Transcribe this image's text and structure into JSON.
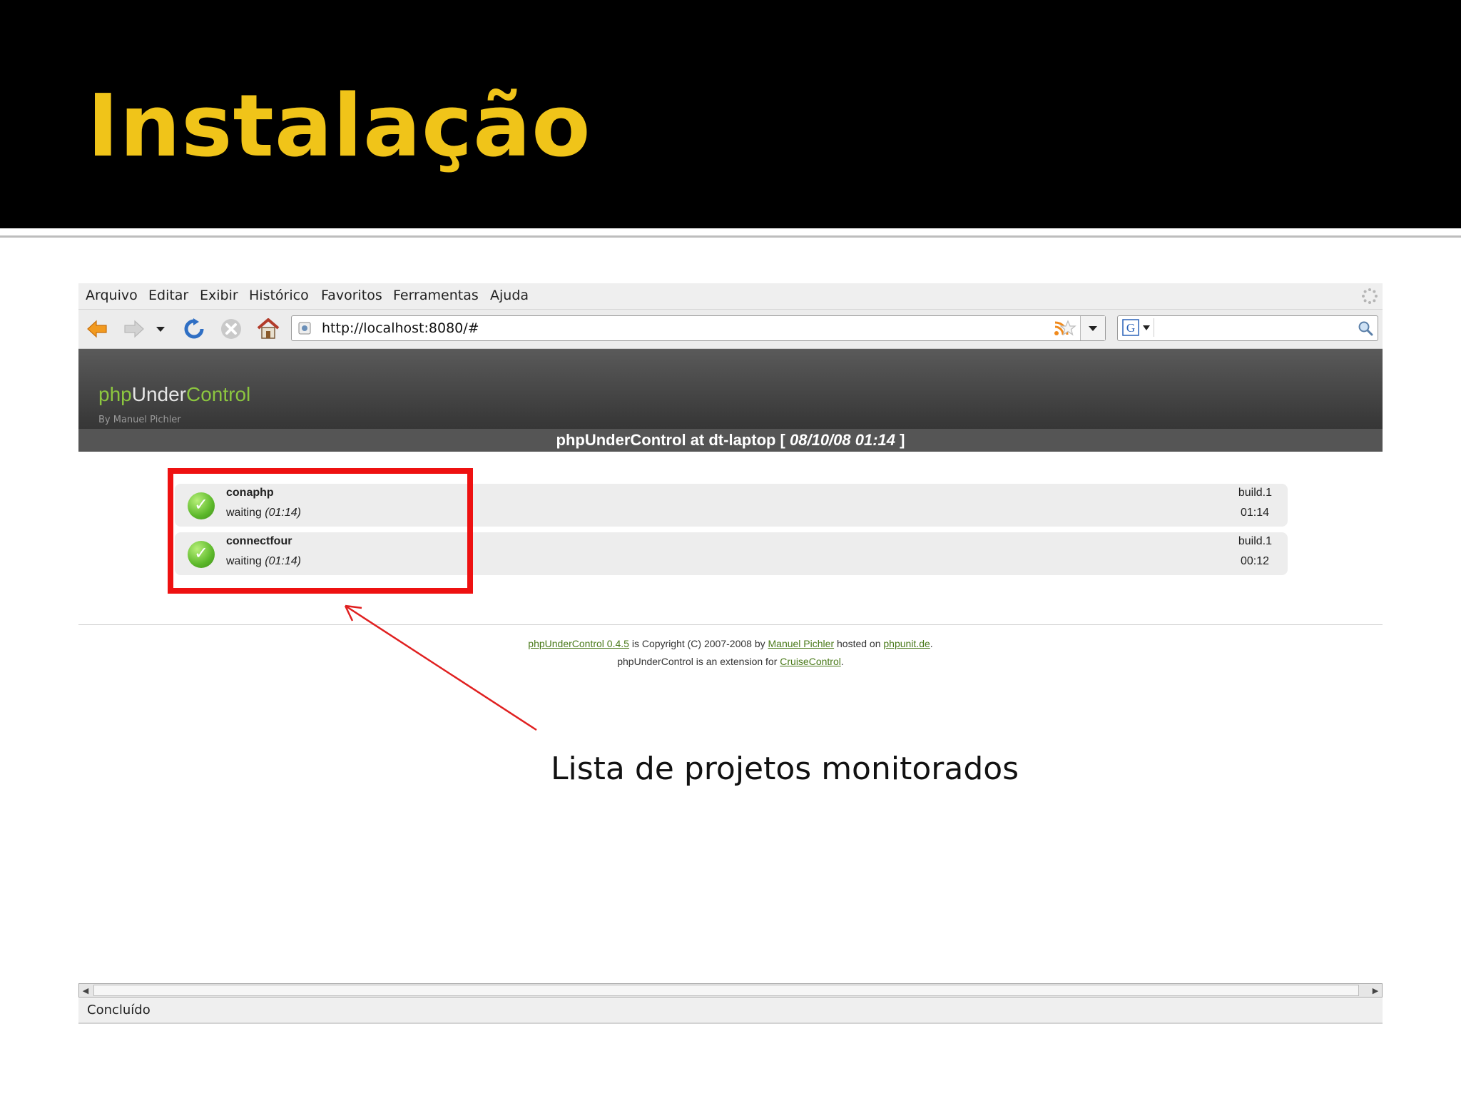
{
  "slide": {
    "title": "Instalação",
    "caption": "Lista de projetos monitorados"
  },
  "browser": {
    "menu": [
      "Arquivo",
      "Editar",
      "Exibir",
      "Histórico",
      "Favoritos",
      "Ferramentas",
      "Ajuda"
    ],
    "url": "http://localhost:8080/#",
    "search_placeholder": "",
    "status": "Concluído",
    "icons": [
      "back-arrow-icon",
      "forward-arrow-icon",
      "history-dropdown-icon",
      "reload-icon",
      "stop-icon",
      "home-icon",
      "site-identity-icon",
      "rss-feed-icon",
      "bookmark-star-icon",
      "google-search-icon",
      "magnifier-icon"
    ]
  },
  "page": {
    "logo": {
      "part1": "php",
      "part2": "Under",
      "part3": "Control",
      "byline": "By Manuel Pichler"
    },
    "header": {
      "prefix": "phpUnderControl at dt-laptop [ ",
      "timestamp": "08/10/08 01:14",
      "suffix": " ]"
    },
    "projects": [
      {
        "name": "conaphp",
        "state": "waiting",
        "since": "(01:14)",
        "build": "build.1",
        "time": "01:14"
      },
      {
        "name": "connectfour",
        "state": "waiting",
        "since": "(01:14)",
        "build": "build.1",
        "time": "00:12"
      }
    ],
    "footer": {
      "line1_link1": "phpUnderControl 0.4.5",
      "line1_text1": " is Copyright (C) 2007-2008 by ",
      "line1_link2": "Manuel Pichler",
      "line1_text2": " hosted on ",
      "line1_link3": "phpunit.de",
      "line1_text3": ".",
      "line2_text1": "phpUnderControl is an extension for ",
      "line2_link1": "CruiseControl",
      "line2_text2": "."
    }
  },
  "colors": {
    "title": "#f0c419",
    "highlight": "#ee1111",
    "logo_green": "#8cc63f",
    "success_green": "#5cb82a"
  }
}
